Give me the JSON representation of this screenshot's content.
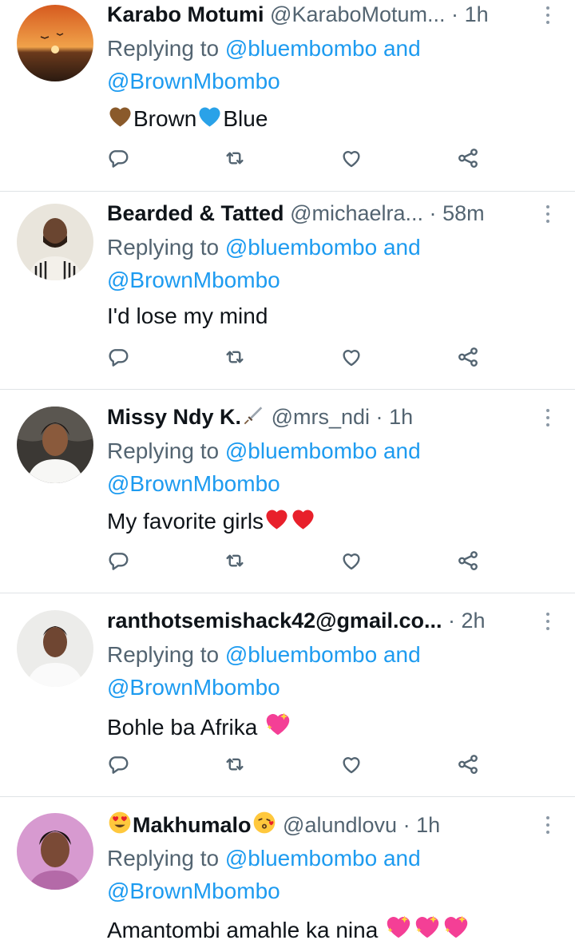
{
  "replying_label": "Replying to",
  "and_label": "and",
  "dot_separator": "·",
  "colors": {
    "link": "#1d9bf0",
    "secondary": "#536471",
    "text": "#0f1419",
    "divider": "#dfe3e6"
  },
  "icons": {
    "reply": "reply-icon",
    "retweet": "retweet-icon",
    "like": "heart-icon",
    "share": "share-icon",
    "more": "more-vertical-icon"
  },
  "tweets": [
    {
      "name": "Karabo Motumi",
      "handle": "@KaraboMotum...",
      "time": "1h",
      "mention1": "@bluembombo",
      "mention2": "@BrownMbombo",
      "text_a": "Brown",
      "text_b": "Blue",
      "text": ""
    },
    {
      "name": "Bearded & Tatted",
      "handle": "@michaelra...",
      "time": "58m",
      "mention1": "@bluembombo",
      "mention2": "@BrownMbombo",
      "text": "I'd lose my mind"
    },
    {
      "name": "Missy Ndy K.",
      "handle": "@mrs_ndi",
      "time": "1h",
      "mention1": "@bluembombo",
      "mention2": "@BrownMbombo",
      "text": "My favorite girls"
    },
    {
      "name": "ranthotsemishack42@gmail.co...",
      "handle": "",
      "time": "2h",
      "mention1": "@bluembombo",
      "mention2": "@BrownMbombo",
      "text": "Bohle ba Afrika "
    },
    {
      "name": "Makhumalo",
      "handle": "@alundlovu",
      "time": "1h",
      "mention1": "@bluembombo",
      "mention2": "@BrownMbombo",
      "text": "Amantombi amahle ka nina "
    }
  ]
}
